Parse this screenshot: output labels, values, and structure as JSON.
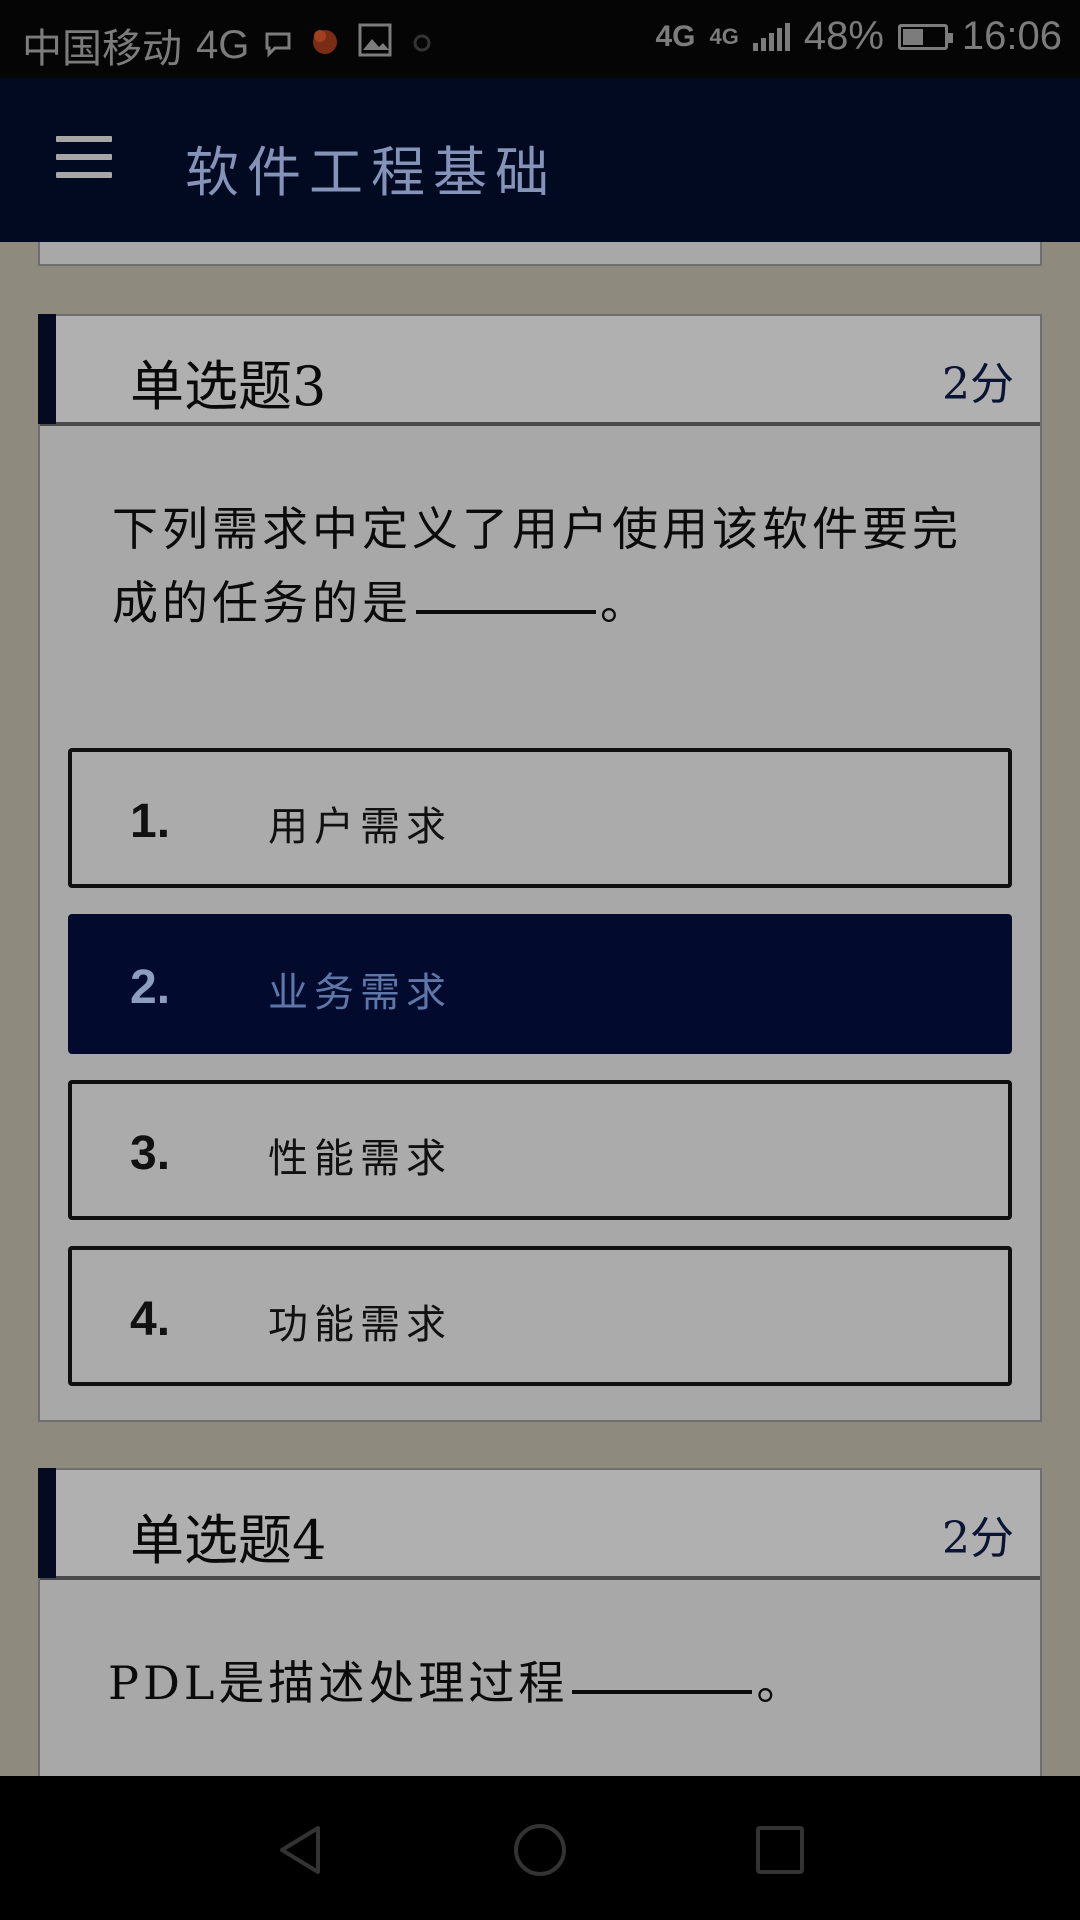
{
  "status": {
    "carrier": "中国移动",
    "network": "4G",
    "right_network1": "4G",
    "right_network2": "4G",
    "battery": "48%",
    "time": "16:06"
  },
  "app_bar": {
    "title": "软件工程基础"
  },
  "questions": [
    {
      "label": "单选题3",
      "points": "2分",
      "text_line1": "下列需求中定义了用户使用该软件要完",
      "text_line2": "成的任务的是",
      "text_end": "。",
      "options": [
        {
          "num": "1.",
          "label": "用户需求",
          "selected": false
        },
        {
          "num": "2.",
          "label": "业务需求",
          "selected": true
        },
        {
          "num": "3.",
          "label": "性能需求",
          "selected": false
        },
        {
          "num": "4.",
          "label": "功能需求",
          "selected": false
        }
      ]
    },
    {
      "label": "单选题4",
      "points": "2分",
      "text_line1": "PDL是描述处理过程",
      "text_end": "。"
    }
  ],
  "colors": {
    "app_bar": "#020a22",
    "selected_option": "#020b2e",
    "card": "#a8a8a8"
  }
}
